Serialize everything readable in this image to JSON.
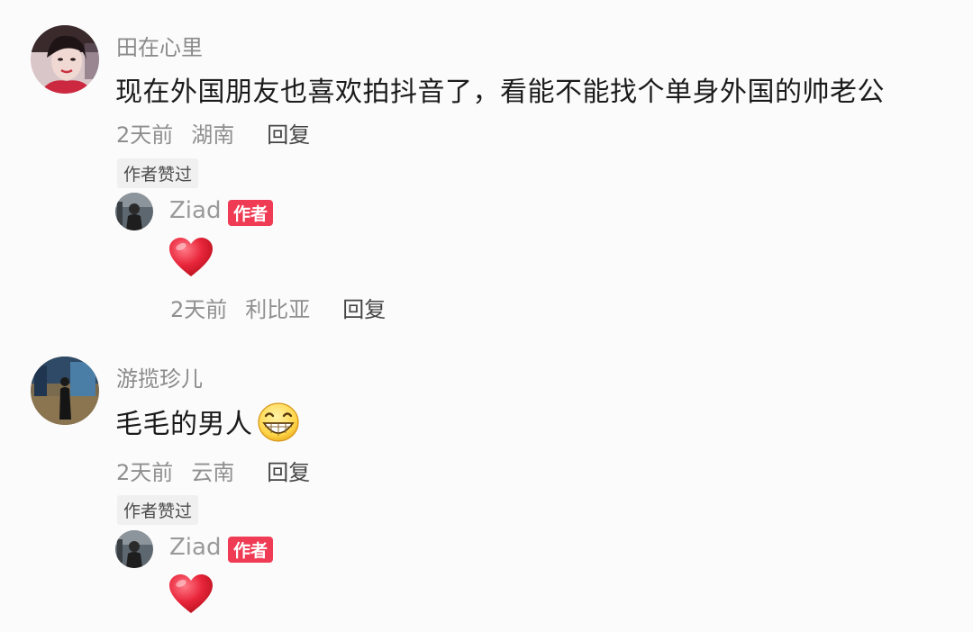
{
  "comments": [
    {
      "username": "田在心里",
      "text": "现在外国朋友也喜欢拍抖音了，看能不能找个单身外国的帅老公",
      "time": "2天前",
      "location": "湖南",
      "reply_label": "回复",
      "liked_label": "作者赞过",
      "author_reply": {
        "name": "Ziad",
        "badge": "作者",
        "emoji": "heart-icon",
        "time": "2天前",
        "location": "利比亚",
        "reply_label": "回复"
      }
    },
    {
      "username": "游揽珍儿",
      "text": "毛毛的男人",
      "emoji": "grinning-face-icon",
      "time": "2天前",
      "location": "云南",
      "reply_label": "回复",
      "liked_label": "作者赞过",
      "author_reply": {
        "name": "Ziad",
        "badge": "作者",
        "emoji": "heart-icon"
      }
    }
  ],
  "colors": {
    "badge": "#ef3c54",
    "heart": "#e8253a",
    "background": "#fbfbfb"
  }
}
